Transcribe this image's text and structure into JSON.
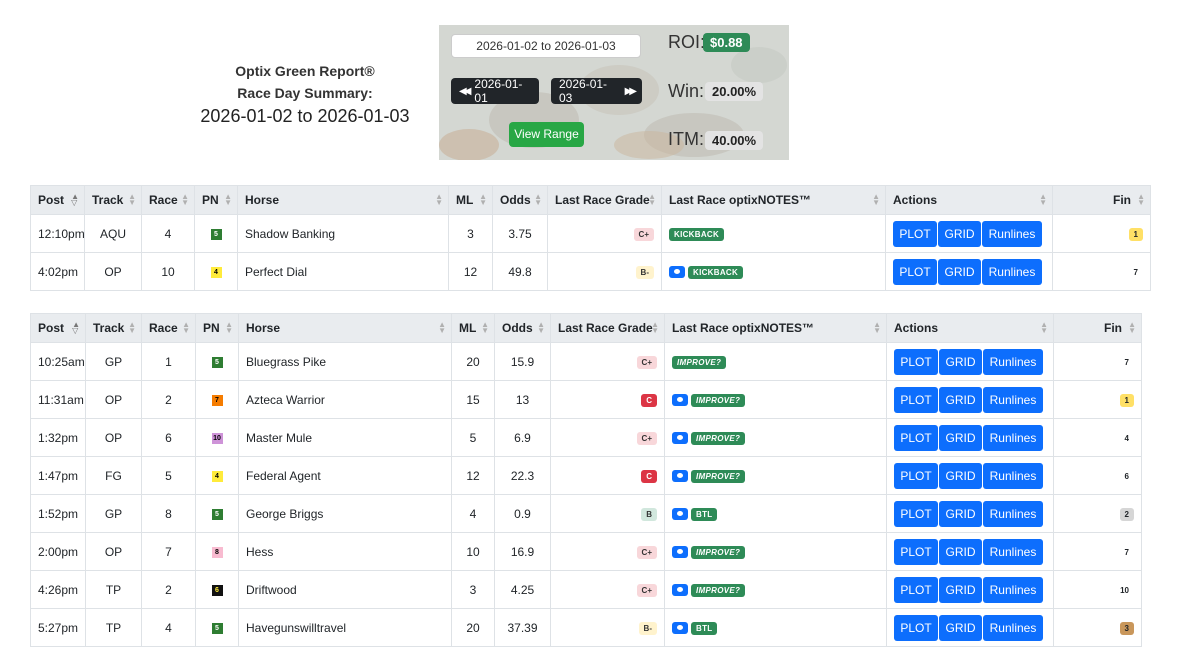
{
  "header": {
    "line1": "Optix Green Report®",
    "line2": "Race Day Summary:",
    "range": "2026-01-02 to 2026-01-03"
  },
  "summary": {
    "date_range_value": "2026-01-02 to 2026-01-03",
    "prev_label": "2026-01-01",
    "next_label": "2026-01-03",
    "view_range_label": "View Range",
    "roi_label": "ROI:",
    "roi_value": "$0.88",
    "win_label": "Win:",
    "win_value": "20.00%",
    "itm_label": "ITM:",
    "itm_value": "40.00%"
  },
  "columns": [
    "Post",
    "Track",
    "Race",
    "PN",
    "Horse",
    "ML",
    "Odds",
    "Last Race Grade",
    "Last Race optixNOTES™",
    "Actions",
    "Fin"
  ],
  "action_labels": {
    "plot": "PLOT",
    "grid": "GRID",
    "runlines": "Runlines"
  },
  "colors": {
    "header_bg": "#e9ecef",
    "action_button": "#0d6efd",
    "tag_green": "#2e8b57"
  },
  "tables": [
    {
      "rows": [
        {
          "post": "12:10pm",
          "track": "AQU",
          "race": "4",
          "pn": "5",
          "pn_bg": "#2e7d32",
          "pn_fg": "#ffffff",
          "horse": "Shadow Banking",
          "ml": "3",
          "odds": "3.75",
          "grade": "C+",
          "grade_bg": "#f8d7da",
          "grade_fg": "#333",
          "note_icon": false,
          "note": "KICKBACK",
          "note_italic": false,
          "fin": "1",
          "fin_bg": "#ffe066"
        },
        {
          "post": "4:02pm",
          "track": "OP",
          "race": "10",
          "pn": "4",
          "pn_bg": "#ffeb3b",
          "pn_fg": "#000000",
          "horse": "Perfect Dial",
          "ml": "12",
          "odds": "49.8",
          "grade": "B-",
          "grade_bg": "#fff3cd",
          "grade_fg": "#333",
          "note_icon": true,
          "note": "KICKBACK",
          "note_italic": false,
          "fin": "7",
          "fin_bg": "transparent"
        }
      ]
    },
    {
      "rows": [
        {
          "post": "10:25am",
          "track": "GP",
          "race": "1",
          "pn": "5",
          "pn_bg": "#2e7d32",
          "pn_fg": "#ffffff",
          "horse": "Bluegrass Pike",
          "ml": "20",
          "odds": "15.9",
          "grade": "C+",
          "grade_bg": "#f8d7da",
          "grade_fg": "#333",
          "note_icon": false,
          "note": "IMPROVE?",
          "note_italic": true,
          "fin": "7",
          "fin_bg": "transparent"
        },
        {
          "post": "11:31am",
          "track": "OP",
          "race": "2",
          "pn": "7",
          "pn_bg": "#f57c00",
          "pn_fg": "#000000",
          "horse": "Azteca Warrior",
          "ml": "15",
          "odds": "13",
          "grade": "C",
          "grade_bg": "#dc3545",
          "grade_fg": "#ffffff",
          "note_icon": true,
          "note": "IMPROVE?",
          "note_italic": true,
          "fin": "1",
          "fin_bg": "#ffe066"
        },
        {
          "post": "1:32pm",
          "track": "OP",
          "race": "6",
          "pn": "10",
          "pn_bg": "#ce93d8",
          "pn_fg": "#000000",
          "horse": "Master Mule",
          "ml": "5",
          "odds": "6.9",
          "grade": "C+",
          "grade_bg": "#f8d7da",
          "grade_fg": "#333",
          "note_icon": true,
          "note": "IMPROVE?",
          "note_italic": true,
          "fin": "4",
          "fin_bg": "transparent"
        },
        {
          "post": "1:47pm",
          "track": "FG",
          "race": "5",
          "pn": "4",
          "pn_bg": "#ffeb3b",
          "pn_fg": "#000000",
          "horse": "Federal Agent",
          "ml": "12",
          "odds": "22.3",
          "grade": "C",
          "grade_bg": "#dc3545",
          "grade_fg": "#ffffff",
          "note_icon": true,
          "note": "IMPROVE?",
          "note_italic": true,
          "fin": "6",
          "fin_bg": "transparent"
        },
        {
          "post": "1:52pm",
          "track": "GP",
          "race": "8",
          "pn": "5",
          "pn_bg": "#2e7d32",
          "pn_fg": "#ffffff",
          "horse": "George Briggs",
          "ml": "4",
          "odds": "0.9",
          "grade": "B",
          "grade_bg": "#d1e7dd",
          "grade_fg": "#333",
          "note_icon": true,
          "note": "BTL",
          "note_italic": false,
          "fin": "2",
          "fin_bg": "#d6d6d6"
        },
        {
          "post": "2:00pm",
          "track": "OP",
          "race": "7",
          "pn": "8",
          "pn_bg": "#f8bbd0",
          "pn_fg": "#000000",
          "horse": "Hess",
          "ml": "10",
          "odds": "16.9",
          "grade": "C+",
          "grade_bg": "#f8d7da",
          "grade_fg": "#333",
          "note_icon": true,
          "note": "IMPROVE?",
          "note_italic": true,
          "fin": "7",
          "fin_bg": "transparent"
        },
        {
          "post": "4:26pm",
          "track": "TP",
          "race": "2",
          "pn": "6",
          "pn_bg": "#111111",
          "pn_fg": "#ffeb3b",
          "horse": "Driftwood",
          "ml": "3",
          "odds": "4.25",
          "grade": "C+",
          "grade_bg": "#f8d7da",
          "grade_fg": "#333",
          "note_icon": true,
          "note": "IMPROVE?",
          "note_italic": true,
          "fin": "10",
          "fin_bg": "transparent"
        },
        {
          "post": "5:27pm",
          "track": "TP",
          "race": "4",
          "pn": "5",
          "pn_bg": "#2e7d32",
          "pn_fg": "#ffffff",
          "horse": "Havegunswilltravel",
          "ml": "20",
          "odds": "37.39",
          "grade": "B-",
          "grade_bg": "#fff3cd",
          "grade_fg": "#333",
          "note_icon": true,
          "note": "BTL",
          "note_italic": false,
          "fin": "3",
          "fin_bg": "#c9975b"
        }
      ]
    }
  ]
}
